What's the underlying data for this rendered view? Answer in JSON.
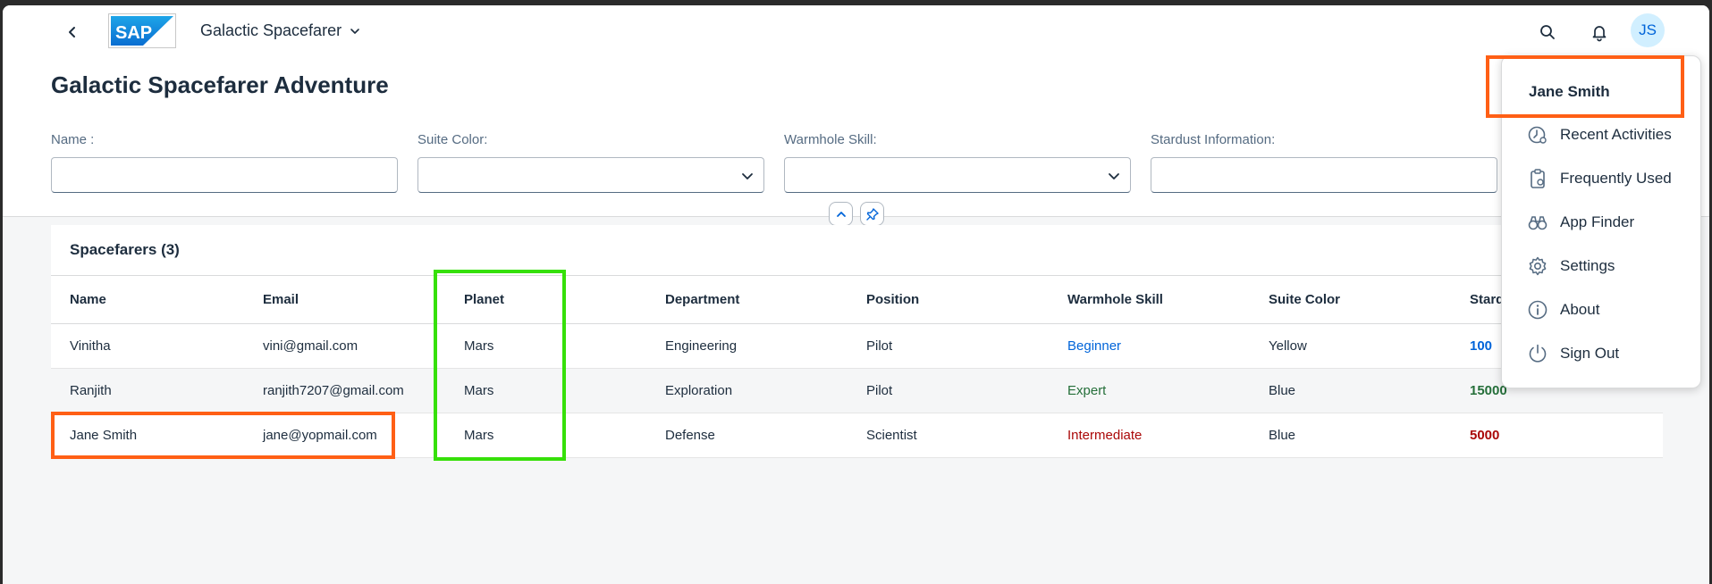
{
  "shell": {
    "app_title": "Galactic Spacefarer",
    "logo_text": "SAP",
    "avatar_initials": "JS"
  },
  "header": {
    "page_title": "Galactic Spacefarer Adventure",
    "filters": [
      {
        "label": "Name :",
        "value": ""
      },
      {
        "label": "Suite Color:",
        "value": ""
      },
      {
        "label": "Warmhole Skill:",
        "value": ""
      },
      {
        "label": "Stardust Information:",
        "value": ""
      }
    ]
  },
  "table": {
    "title": "Spacefarers (3)",
    "columns": [
      "Name",
      "Email",
      "Planet",
      "Department",
      "Position",
      "Warmhole Skill",
      "Suite Color",
      "Stard"
    ],
    "rows": [
      [
        "Vinitha",
        "vini@gmail.com",
        "Mars",
        "Engineering",
        "Pilot",
        "Beginner",
        "Yellow",
        "100"
      ],
      [
        "Ranjith",
        "ranjith7207@gmail.com",
        "Mars",
        "Exploration",
        "Pilot",
        "Expert",
        "Blue",
        "15000"
      ],
      [
        "Jane Smith",
        "jane@yopmail.com",
        "Mars",
        "Defense",
        "Scientist",
        "Intermediate",
        "Blue",
        "5000"
      ]
    ]
  },
  "user_menu": {
    "name": "Jane Smith",
    "items": [
      {
        "label": "Recent Activities",
        "icon": "recent-activities-icon"
      },
      {
        "label": "Frequently Used",
        "icon": "frequently-used-icon"
      },
      {
        "label": "App Finder",
        "icon": "app-finder-icon"
      },
      {
        "label": "Settings",
        "icon": "gear-icon"
      },
      {
        "label": "About",
        "icon": "info-icon"
      },
      {
        "label": "Sign Out",
        "icon": "power-icon"
      }
    ]
  },
  "colors": {
    "highlight_orange": "#ff5f15",
    "highlight_green": "#36e009",
    "beginner": "#0064d9",
    "expert": "#256f3a",
    "intermediate": "#aa0808"
  }
}
